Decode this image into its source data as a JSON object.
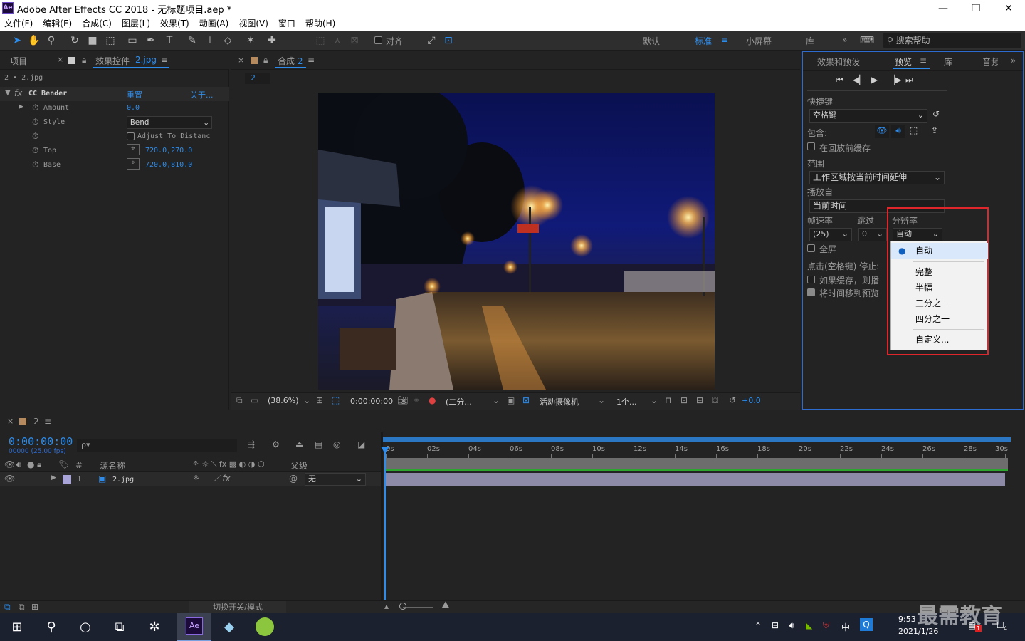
{
  "app": {
    "logo": "Ae",
    "title": "Adobe After Effects CC 2018 - 无标题项目.aep *"
  },
  "window_controls": {
    "minimize": "—",
    "restore": "❐",
    "close": "✕"
  },
  "menu": [
    "文件(F)",
    "编辑(E)",
    "合成(C)",
    "图层(L)",
    "效果(T)",
    "动画(A)",
    "视图(V)",
    "窗口",
    "帮助(H)"
  ],
  "toolbar": {
    "align_label": "对齐",
    "workspaces": [
      "默认",
      "标准",
      "小屏幕",
      "库"
    ],
    "more": "»",
    "search_placeholder": "搜索帮助"
  },
  "left_panel": {
    "tab_project": "项目",
    "tab_effects": "效果控件",
    "tab_effects_file": "2.jpg",
    "menu_icon": "≡",
    "breadcrumb": "2 • 2.jpg",
    "effect_name": "CC Bender",
    "reset": "重置",
    "about": "关于...",
    "props": [
      {
        "name": "Amount",
        "value": "0.0"
      },
      {
        "name": "Style",
        "value": "Bend"
      },
      {
        "name": "",
        "value": "Adjust To Distanc"
      },
      {
        "name": "Top",
        "value": "720.0,270.0"
      },
      {
        "name": "Base",
        "value": "720.0,810.0"
      }
    ]
  },
  "comp_panel": {
    "tab_label": "合成",
    "tab_name": "2",
    "comp_crumb": "2",
    "zoom": "(38.6%)",
    "timecode": "0:00:00:00",
    "resolution": "(二分...",
    "camera": "活动摄像机",
    "views": "1个...",
    "exposure": "+0.0"
  },
  "preview_panel": {
    "tabs": [
      "效果和预设",
      "预览",
      "库",
      "音频"
    ],
    "shortcut_label": "快捷键",
    "shortcut_value": "空格键",
    "include_label": "包含:",
    "cache_before": "在回放前缓存",
    "range_label": "范围",
    "range_value": "工作区域按当前时间延伸",
    "play_from_label": "播放自",
    "play_from_value": "当前时间",
    "fps_label": "帧速率",
    "skip_label": "跳过",
    "res_label": "分辨率",
    "fps_value": "(25)",
    "skip_value": "0",
    "res_value": "自动",
    "fullscreen": "全屏",
    "click_stop": "点击(空格键) 停止:",
    "if_cached": "如果缓存，则播",
    "move_time": "将时间移到预览",
    "dropdown_options": [
      "自动",
      "完整",
      "半幅",
      "三分之一",
      "四分之一",
      "自定义..."
    ],
    "dropdown_selected": "自动"
  },
  "timeline": {
    "tab_name": "2",
    "timecode": "0:00:00:00",
    "fps_info": "00000 (25.00 fps)",
    "search_placeholder": "ρ▾",
    "col_hash": "#",
    "col_source": "源名称",
    "col_parent": "父级",
    "layer_index": "1",
    "layer_name": "2.jpg",
    "layer_parent": "无",
    "ruler": [
      "0s",
      "02s",
      "04s",
      "06s",
      "08s",
      "10s",
      "12s",
      "14s",
      "16s",
      "18s",
      "20s",
      "22s",
      "24s",
      "26s",
      "28s",
      "30s"
    ],
    "toggle_modes": "切换开关/模式"
  },
  "taskbar": {
    "time": "9:53",
    "date": "2021/1/26",
    "ime": "中",
    "badge1": "1",
    "badge2": "4",
    "watermark": "最需教育"
  },
  "colors": {
    "accent": "#2d8ceb",
    "highlight_box": "#e0262b",
    "preview_border": "#2d6bd0"
  }
}
